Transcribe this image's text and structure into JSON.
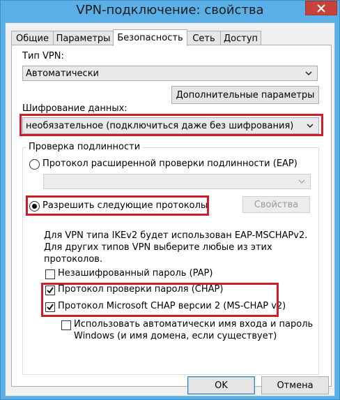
{
  "window": {
    "title": "VPN-подключение: свойства",
    "close_glyph": "✕"
  },
  "tabs": [
    {
      "label": "Общие"
    },
    {
      "label": "Параметры"
    },
    {
      "label": "Безопасность",
      "active": true
    },
    {
      "label": "Сеть"
    },
    {
      "label": "Доступ"
    }
  ],
  "vpn_type": {
    "label": "Тип VPN:",
    "value": "Автоматически"
  },
  "advanced_button": "Дополнительные параметры",
  "encryption": {
    "label": "Шифрование данных:",
    "value": "необязательное (подключиться даже без шифрования)"
  },
  "auth": {
    "caption": "Проверка подлинности",
    "eap_option": "Протокол расширенной проверки подлинности (EAP)",
    "eap_combo_value": "",
    "allow_option": "Разрешить следующие протоколы",
    "properties_button": "Свойства",
    "description": [
      "Для VPN типа IKEv2 будет использован EAP-MSCHAPv2.",
      "Для других типов VPN выберите любые из этих",
      "протоколов."
    ],
    "protocols": [
      {
        "label": "Незашифрованный пароль (PAP)",
        "checked": false
      },
      {
        "label": "Протокол проверки пароля (CHAP)",
        "checked": true
      },
      {
        "label": "Протокол Microsoft CHAP версии 2 (MS-CHAP v2)",
        "checked": true
      }
    ],
    "auto_login": {
      "line1": "Использовать автоматически имя входа и пароль",
      "line2": "Windows (и имя домена, если существует)",
      "checked": false
    }
  },
  "footer": {
    "ok": "OK",
    "cancel": "Отмена"
  },
  "colors": {
    "titlebar": "#5ab0e6",
    "close_button": "#c7423b",
    "highlight_box": "#d11a2a"
  }
}
